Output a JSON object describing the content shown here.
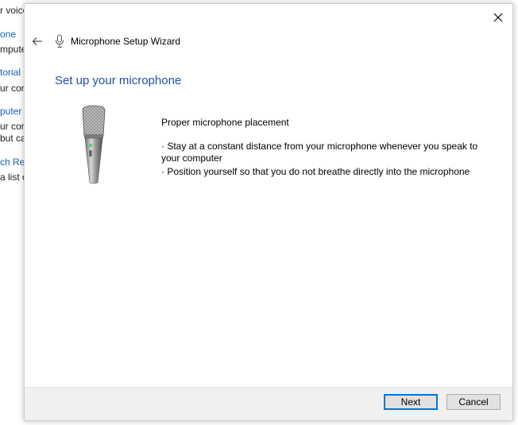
{
  "background_panel": {
    "lines": [
      {
        "text": "r voice",
        "type": "text"
      },
      {
        "text": "one",
        "type": "link"
      },
      {
        "text": "mpute",
        "type": "text"
      },
      {
        "text": "torial",
        "type": "link"
      },
      {
        "text": "ur con",
        "type": "text"
      },
      {
        "text": "puter",
        "type": "link"
      },
      {
        "text": "ur con",
        "type": "text"
      },
      {
        "text": "but ca",
        "type": "text"
      },
      {
        "text": "ch Ref",
        "type": "link"
      },
      {
        "text": "a list o",
        "type": "text"
      }
    ]
  },
  "wizard": {
    "window_title": "Microphone Setup Wizard",
    "heading": "Set up your microphone",
    "placement_title": "Proper microphone placement",
    "bullets": [
      "· Stay at a constant distance from your microphone whenever you speak to your computer",
      "· Position yourself so that you do not breathe directly into the microphone"
    ],
    "buttons": {
      "next": "Next",
      "cancel": "Cancel"
    }
  },
  "icons": {
    "back": "back-arrow-icon",
    "close": "close-icon",
    "title": "microphone-icon",
    "illustration": "microphone-illustration"
  },
  "colors": {
    "heading": "#1f4e9a",
    "link": "#1a5fb4",
    "footer": "#f0f0f0",
    "primary_button_border": "#0078d7"
  }
}
